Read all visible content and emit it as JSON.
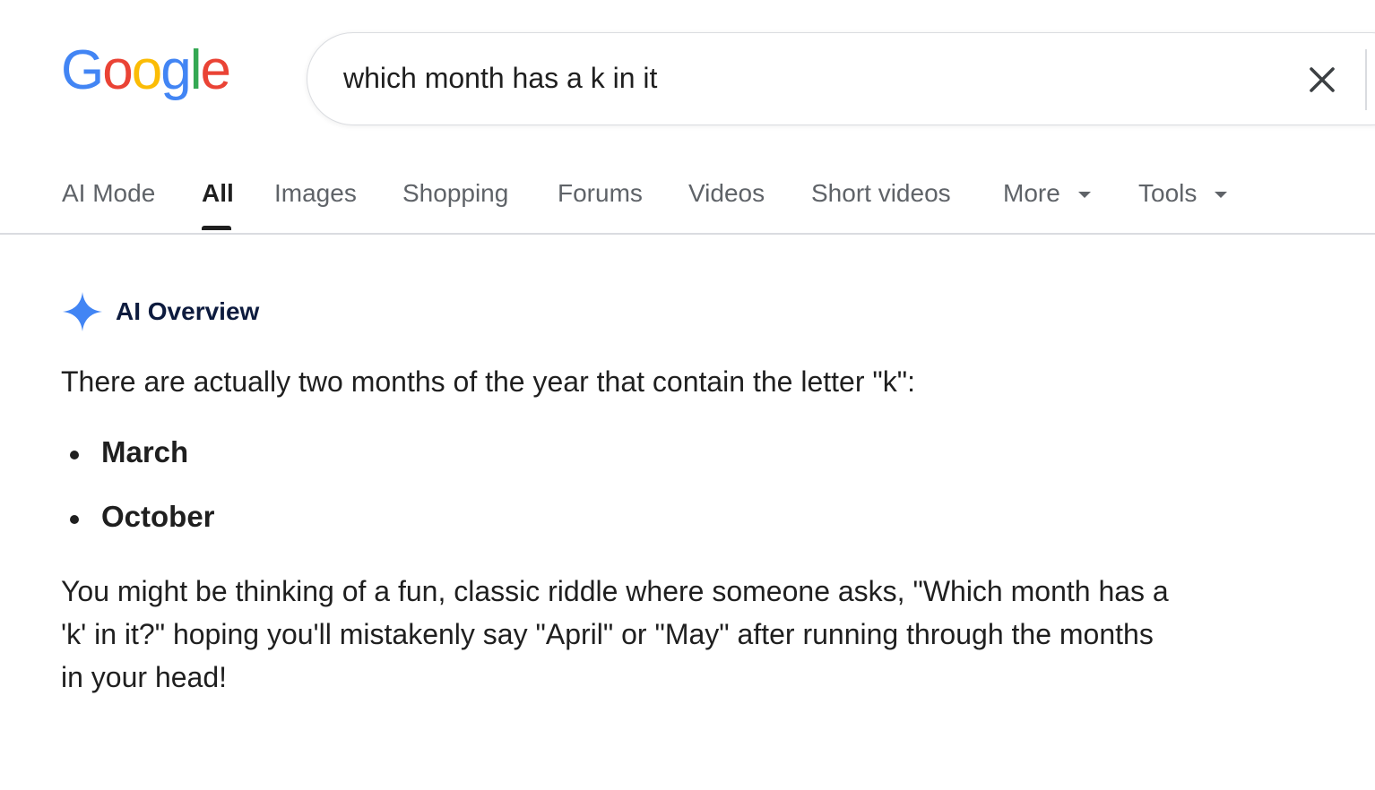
{
  "logo": {
    "letters": [
      {
        "char": "G",
        "color": "#4285F4"
      },
      {
        "char": "o",
        "color": "#EA4335"
      },
      {
        "char": "o",
        "color": "#FBBC05"
      },
      {
        "char": "g",
        "color": "#4285F4"
      },
      {
        "char": "l",
        "color": "#34A853"
      },
      {
        "char": "e",
        "color": "#EA4335"
      }
    ]
  },
  "search": {
    "query": "which month has a k in it"
  },
  "tabs": [
    {
      "label": "AI Mode"
    },
    {
      "label": "All",
      "active": true
    },
    {
      "label": "Images"
    },
    {
      "label": "Shopping"
    },
    {
      "label": "Forums"
    },
    {
      "label": "Videos"
    },
    {
      "label": "Short videos"
    },
    {
      "label": "More",
      "dropdown": true
    },
    {
      "label": "Tools",
      "dropdown": true
    }
  ],
  "ai_overview": {
    "title": "AI Overview",
    "icon": "sparkle-icon",
    "accent_color": "#4285F4",
    "intro": "There are actually two months of the year that contain the letter \"k\":",
    "bullets": [
      "March",
      "October"
    ],
    "paragraph_lines": [
      "You might be thinking of a fun, classic riddle where someone asks, \"Which month has a",
      "'k' in it?\" hoping you'll mistakenly say \"April\" or \"May\" after running through the months",
      "in your head!"
    ]
  }
}
